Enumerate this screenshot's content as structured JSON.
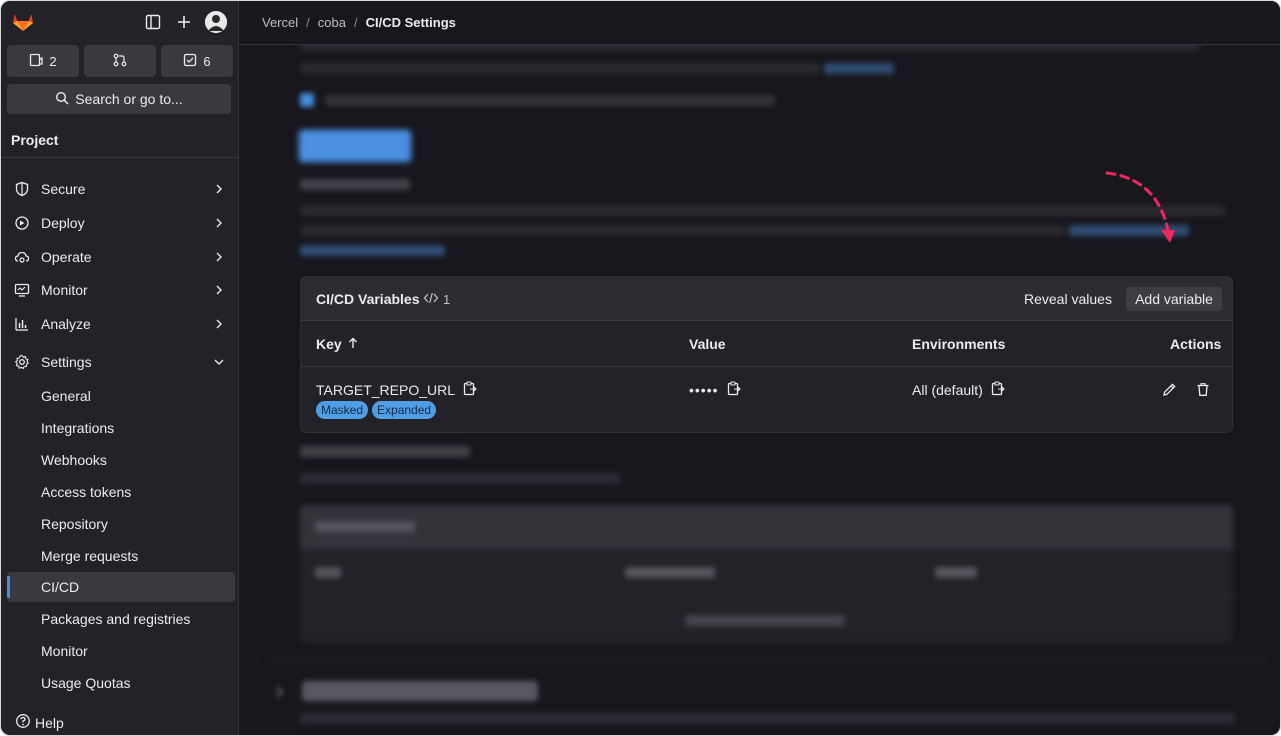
{
  "sidebar": {
    "counters": [
      {
        "icon": "issues-icon",
        "count": "2"
      },
      {
        "icon": "merge-request-icon",
        "count": ""
      },
      {
        "icon": "todo-icon",
        "count": "6"
      }
    ],
    "search_label": "Search or go to...",
    "project_heading": "Project",
    "nav_items": [
      {
        "label": "Secure"
      },
      {
        "label": "Deploy"
      },
      {
        "label": "Operate"
      },
      {
        "label": "Monitor"
      },
      {
        "label": "Analyze"
      },
      {
        "label": "Settings"
      }
    ],
    "settings_items": [
      {
        "label": "General"
      },
      {
        "label": "Integrations"
      },
      {
        "label": "Webhooks"
      },
      {
        "label": "Access tokens"
      },
      {
        "label": "Repository"
      },
      {
        "label": "Merge requests"
      },
      {
        "label": "CI/CD"
      },
      {
        "label": "Packages and registries"
      },
      {
        "label": "Monitor"
      },
      {
        "label": "Usage Quotas"
      }
    ],
    "help_label": "Help"
  },
  "breadcrumb": [
    "Vercel",
    "coba",
    "CI/CD Settings"
  ],
  "variables_card": {
    "title": "CI/CD Variables",
    "count": "1",
    "reveal_label": "Reveal values",
    "add_label": "Add variable",
    "columns": [
      "Key",
      "Value",
      "Environments",
      "Actions"
    ],
    "rows": [
      {
        "key": "TARGET_REPO_URL",
        "value": "•••••",
        "environment": "All (default)",
        "badges": [
          "Masked",
          "Expanded"
        ]
      }
    ]
  },
  "colors": {
    "accent": "#428fdc",
    "annotation_arrow": "#f0265e",
    "badge": "#4f9ee6"
  }
}
